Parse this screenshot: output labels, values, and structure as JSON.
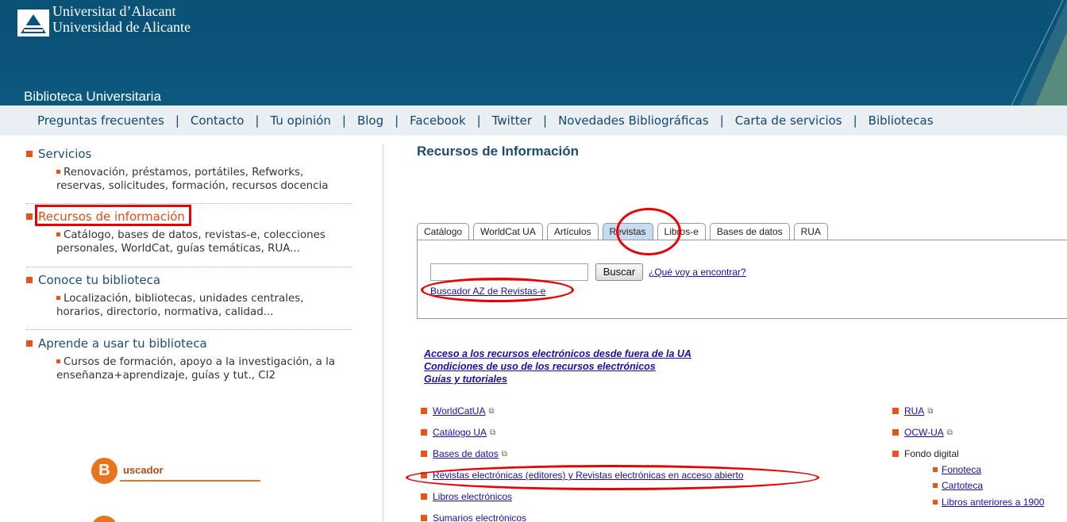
{
  "header": {
    "university_line1": "Universitat d’Alacant",
    "university_line2": "Universidad de Alicante",
    "library_title": "Biblioteca Universitaria"
  },
  "topnav": {
    "items": [
      "Preguntas frecuentes",
      "Contacto",
      "Tu opinión",
      "Blog",
      "Facebook",
      "Twitter",
      "Novedades Bibliográficas",
      "Carta de servicios",
      "Bibliotecas"
    ],
    "separator": "|"
  },
  "sidebar": {
    "sections": [
      {
        "title": "Servicios",
        "desc_line1": "Renovación, préstamos, portátiles, Refworks,",
        "desc_line2": "reservas, solicitudes, formación, recursos docencia"
      },
      {
        "title": "Recursos de información",
        "desc_line1": "Catálogo, bases de datos, revistas-e, colecciones",
        "desc_line2": "personales, WorldCat, guías temáticas, RUA..."
      },
      {
        "title": "Conoce tu biblioteca",
        "desc_line1": "Localización, bibliotecas, unidades centrales,",
        "desc_line2": "horarios, directorio, normativa, calidad..."
      },
      {
        "title": "Aprende a usar tu biblioteca",
        "desc_line1": "Cursos de formación, apoyo a la investigación, a la",
        "desc_line2": "enseñanza+aprendizaje, guías y tut., CI2"
      }
    ],
    "buscador_letter": "B",
    "buscador_word": "uscador"
  },
  "main": {
    "title": "Recursos de Información",
    "tabs": [
      "Catálogo",
      "WorldCat UA",
      "Artículos",
      "Revistas",
      "Libros-e",
      "Bases de datos",
      "RUA"
    ],
    "active_tab": "Revistas",
    "search": {
      "button_label": "Buscar",
      "help_link": "¿Qué voy a encontrar?",
      "az_link": "Buscador AZ de Revistas-e"
    },
    "bold_links": [
      "Acceso a los recursos electrónicos desde fuera de la UA",
      "Condiciones de uso de los recursos electrónicos",
      "Guías y tutoriales"
    ],
    "resources_left": [
      "WorldCatUA",
      "Catálogo UA",
      "Bases de datos",
      "Revistas electrónicas (editores) y Revistas electrónicas en acceso abierto",
      "Libros electrónicos",
      "Sumarios electrónicos"
    ],
    "resources_right": [
      "RUA",
      "OCW-UA",
      "Fondo digital"
    ],
    "fondo_digital_sub": [
      "Fonoteca",
      "Cartoteca",
      "Libros anteriores a 1900"
    ]
  },
  "colors": {
    "header_bg": "#0b5379",
    "nav_bg": "#e9eff3",
    "accent_orange": "#e8531c",
    "annotation_red": "#ee0000",
    "link": "#1a0dab"
  },
  "icons": [
    "university-logo-icon",
    "external-link-icon",
    "square-bullet-icon"
  ]
}
